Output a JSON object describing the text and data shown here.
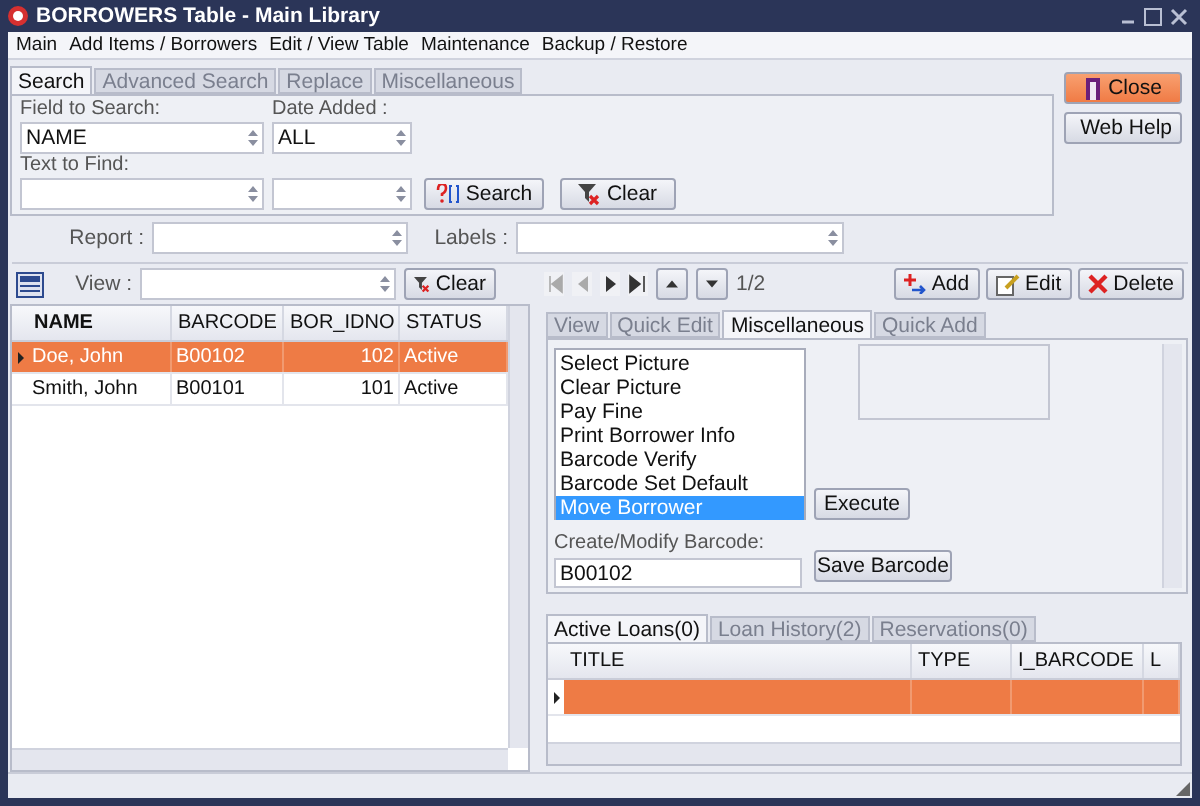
{
  "window": {
    "title": "BORROWERS Table - Main Library"
  },
  "menu": [
    "Main",
    "Add Items / Borrowers",
    "Edit / View Table",
    "Maintenance",
    "Backup / Restore"
  ],
  "search_tabs": [
    {
      "label": "Search",
      "selected": true
    },
    {
      "label": "Advanced Search",
      "selected": false
    },
    {
      "label": "Replace",
      "selected": false
    },
    {
      "label": "Miscellaneous",
      "selected": false
    }
  ],
  "search": {
    "field_label": "Field to Search:",
    "field_value": "NAME",
    "date_label": "Date Added :",
    "date_value": "ALL",
    "text_label": "Text to Find:",
    "search_button": "Search",
    "clear_button": "Clear"
  },
  "side_buttons": {
    "close": "Close",
    "help": "Web Help"
  },
  "report": {
    "label": "Report :",
    "labels_label": "Labels :"
  },
  "view": {
    "label": "View :",
    "clear_button": "Clear"
  },
  "pager": "1/2",
  "record_buttons": [
    {
      "label": "Add",
      "kind": "add"
    },
    {
      "label": "Edit",
      "kind": "edit"
    },
    {
      "label": "Delete",
      "kind": "delete"
    }
  ],
  "table": {
    "columns": [
      "NAME",
      "BARCODE",
      "BOR_IDNO",
      "STATUS"
    ],
    "rows": [
      {
        "cells": [
          "Doe, John",
          "B00102",
          "102",
          "Active"
        ],
        "selected": true
      },
      {
        "cells": [
          "Smith, John",
          "B00101",
          "101",
          "Active"
        ],
        "selected": false
      }
    ]
  },
  "detail_tabs": [
    {
      "label": "View",
      "selected": false
    },
    {
      "label": "Quick Edit",
      "selected": false
    },
    {
      "label": "Miscellaneous",
      "selected": true
    },
    {
      "label": "Quick Add",
      "selected": false
    }
  ],
  "misc": {
    "actions": [
      {
        "label": "Select Picture",
        "selected": false
      },
      {
        "label": "Clear Picture",
        "selected": false
      },
      {
        "label": "Pay Fine",
        "selected": false
      },
      {
        "label": "Print Borrower Info",
        "selected": false
      },
      {
        "label": "Barcode Verify",
        "selected": false
      },
      {
        "label": "Barcode Set Default",
        "selected": false
      },
      {
        "label": "Move Borrower",
        "selected": true
      }
    ],
    "execute_button": "Execute",
    "barcode_label": "Create/Modify Barcode:",
    "barcode_value": "B00102",
    "save_button": "Save Barcode"
  },
  "loan_tabs": [
    {
      "label": "Active Loans(0)",
      "selected": true
    },
    {
      "label": "Loan History(2)",
      "selected": false
    },
    {
      "label": "Reservations(0)",
      "selected": false
    }
  ],
  "loans_table": {
    "columns": [
      "TITLE",
      "TYPE",
      "I_BARCODE",
      "L"
    ],
    "rows": [
      {
        "selected": true
      }
    ]
  }
}
